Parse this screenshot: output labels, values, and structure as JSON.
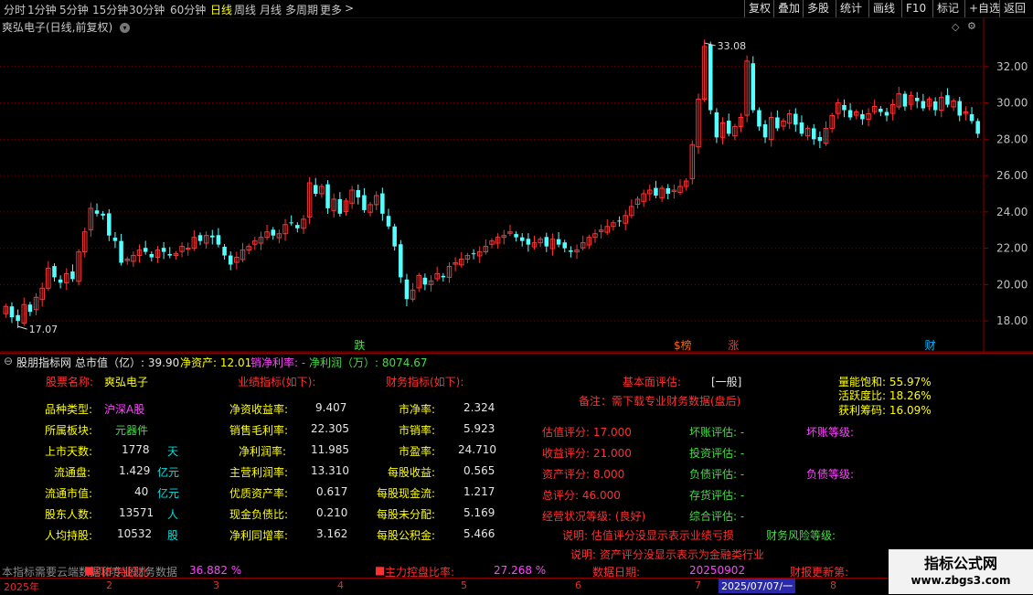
{
  "toolbar": {
    "periods": [
      {
        "label": "分时",
        "active": false
      },
      {
        "label": "1分钟",
        "active": false
      },
      {
        "label": "5分钟",
        "active": false
      },
      {
        "label": "15分钟",
        "active": false
      },
      {
        "label": "30分钟",
        "active": false
      },
      {
        "label": "60分钟",
        "active": false
      },
      {
        "label": "日线",
        "active": true
      },
      {
        "label": "周线",
        "active": false
      },
      {
        "label": "月线",
        "active": false
      },
      {
        "label": "多周期",
        "active": false
      },
      {
        "label": "更多",
        "active": false
      }
    ],
    "more_arrow": ">",
    "right_buttons": [
      "复权",
      "叠加",
      "多股",
      "统计",
      "画线",
      "F10",
      "标记",
      "+自选",
      "返回"
    ]
  },
  "chart": {
    "title": "爽弘电子(日线,前复权)",
    "high_label": "33.08",
    "low_label": "17.07",
    "y_ticks": [
      "32.00",
      "30.00",
      "28.00",
      "26.00",
      "24.00",
      "22.00",
      "20.00",
      "18.00"
    ],
    "markers": [
      {
        "text": "跌",
        "color": "#44dd44"
      },
      {
        "text": "$榜",
        "color": "#ff6600"
      },
      {
        "text": "涨",
        "color": "#ff3030"
      },
      {
        "text": "财",
        "color": "#00bbff"
      }
    ],
    "colors": {
      "up": "#ff3333",
      "down": "#54ffff",
      "grid": "#6e0000",
      "axis": "#c0c0c0"
    }
  },
  "chart_data": {
    "type": "candlestick",
    "title": "爽弘电子(日线,前复权)",
    "ylim": [
      17.0,
      33.6
    ],
    "close": [
      18.8,
      18.2,
      18.0,
      18.9,
      18.5,
      19.3,
      19.8,
      20.9,
      20.4,
      20.1,
      20.6,
      20.3,
      21.8,
      22.9,
      24.2,
      23.9,
      23.8,
      22.7,
      22.4,
      21.2,
      21.4,
      21.6,
      21.9,
      21.8,
      21.5,
      21.9,
      21.8,
      21.6,
      21.7,
      22.1,
      22.0,
      22.6,
      22.4,
      22.7,
      22.6,
      22.2,
      21.6,
      21.1,
      21.5,
      21.9,
      22.1,
      22.4,
      22.6,
      22.9,
      22.7,
      22.8,
      23.3,
      23.4,
      23.1,
      23.6,
      25.6,
      25.0,
      25.4,
      24.2,
      24.7,
      23.9,
      24.6,
      25.2,
      24.8,
      24.1,
      24.4,
      24.9,
      23.9,
      23.2,
      22.1,
      20.4,
      19.2,
      19.7,
      20.5,
      20.0,
      20.2,
      20.6,
      20.4,
      21.0,
      21.2,
      21.4,
      21.6,
      21.7,
      21.8,
      22.1,
      22.4,
      22.6,
      22.7,
      22.9,
      22.6,
      22.4,
      22.2,
      22.3,
      22.5,
      22.1,
      22.5,
      22.2,
      22.0,
      21.8,
      21.9,
      22.3,
      22.6,
      22.8,
      23.0,
      23.2,
      23.4,
      23.5,
      23.8,
      24.3,
      24.7,
      25.0,
      25.2,
      24.9,
      25.3,
      25.0,
      25.2,
      25.4,
      25.7,
      27.7,
      30.2,
      33.1,
      29.6,
      28.1,
      28.9,
      28.3,
      28.7,
      29.2,
      32.3,
      29.6,
      28.7,
      28.1,
      29.2,
      28.6,
      29.0,
      29.4,
      28.8,
      28.3,
      28.6,
      28.0,
      27.9,
      28.6,
      29.3,
      30.0,
      29.6,
      29.2,
      29.5,
      29.1,
      29.4,
      29.8,
      29.5,
      29.3,
      29.9,
      30.5,
      29.8,
      30.4,
      30.1,
      29.7,
      30.2,
      29.6,
      30.3,
      29.9,
      30.1,
      29.3,
      29.5,
      29.0,
      28.3
    ],
    "volume_unit": "",
    "markers": [
      "跌",
      "$榜",
      "涨",
      "财"
    ]
  },
  "indicator": {
    "header": {
      "name": "股朋指标网",
      "mcap": "总市值（亿）: 39.90",
      "net_assets": "净资产: 12.01",
      "net_margin": "销净利率: -",
      "net_profit": "净利润（万）: 8074.67"
    },
    "section_left_title": "股票名称:",
    "stock_name": "爽弘电子",
    "perf_title": "业绩指标(如下):",
    "fin_title": "财务指标(如下):",
    "fund_title": "基本面评估:",
    "fund_value": "[一般]",
    "note": "备注：需下载专业财务数据(盘后)",
    "left": [
      {
        "label": "品种类型:",
        "value": "沪深A股",
        "unit": ""
      },
      {
        "label": "所属板块:",
        "value": "元器件",
        "unit": ""
      },
      {
        "label": "上市天数:",
        "value": "1778",
        "unit": "天"
      },
      {
        "label": "流通盘:",
        "value": "1.429",
        "unit": "亿元"
      },
      {
        "label": "流通市值:",
        "value": "40",
        "unit": "亿元"
      },
      {
        "label": "股东人数:",
        "value": "13571",
        "unit": "人"
      },
      {
        "label": "人均持股:",
        "value": "10532",
        "unit": "股"
      }
    ],
    "perf": [
      {
        "label": "净资收益率:",
        "value": "9.407"
      },
      {
        "label": "销售毛利率:",
        "value": "22.305"
      },
      {
        "label": "净利润率:",
        "value": "11.985"
      },
      {
        "label": "主营利润率:",
        "value": "13.310"
      },
      {
        "label": "优质资产率:",
        "value": "0.617"
      },
      {
        "label": "现金负债比:",
        "value": "0.210"
      },
      {
        "label": "净利同增率:",
        "value": "3.162"
      }
    ],
    "fin": [
      {
        "label": "市净率:",
        "value": "2.324"
      },
      {
        "label": "市销率:",
        "value": "5.923"
      },
      {
        "label": "市盈率:",
        "value": "24.710"
      },
      {
        "label": "每股收益:",
        "value": "0.565"
      },
      {
        "label": "每股现金流:",
        "value": "1.217"
      },
      {
        "label": "每股未分配:",
        "value": "5.169"
      },
      {
        "label": "每股公积金:",
        "value": "5.466"
      }
    ],
    "scores": [
      {
        "label": "估值评分: 17.000"
      },
      {
        "label": "收益评分: 21.000"
      },
      {
        "label": "资产评分: 8.000"
      },
      {
        "label": "总评分: 46.000"
      },
      {
        "label": "经营状况等级: (良好)"
      }
    ],
    "evals": [
      {
        "label": "坏账评估: -"
      },
      {
        "label": "投资评估: -"
      },
      {
        "label": "负债评估: -"
      },
      {
        "label": "存货评估: -"
      },
      {
        "label": "综合评估: -"
      }
    ],
    "bad_debt_level": "坏账等级:",
    "debt_level": "负债等级:",
    "risk_level": "财务风险等级:",
    "explain1": "说明: 估值评分没显示表示业绩亏损",
    "explain2": "说明: 资产评分没显示表示为金融类行业",
    "volume_saturation": "量能饱和: 55.97%",
    "activity": "活跃度比: 18.26%",
    "profit_chips": "获利筹码: 16.09%",
    "footer_note": "本指标需要云端数据和专业财务数据",
    "footer_inst": "机构持股比",
    "footer_inst_value": "36.882  %",
    "footer_main": "主力控盘比率:",
    "footer_main_value": "27.268  %",
    "footer_date_label": "数据日期:",
    "footer_date": "20250902",
    "footer_update": "财报更新第:"
  },
  "date_axis": {
    "ticks": [
      "2025年",
      "2",
      "3",
      "4",
      "5",
      "6",
      "7",
      "8"
    ],
    "cursor": "2025/07/07/一"
  },
  "watermark": {
    "line1": "指标公式网",
    "line2": "www.zbgs3.com"
  }
}
